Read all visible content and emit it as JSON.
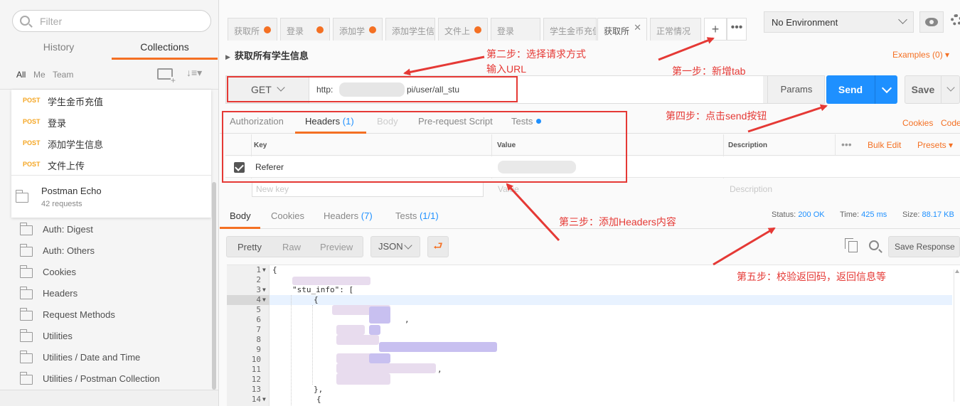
{
  "sidebar": {
    "filter_placeholder": "Filter",
    "tabs": {
      "history": "History",
      "collections": "Collections"
    },
    "filters": {
      "all": "All",
      "me": "Me",
      "team": "Team"
    },
    "requests": [
      {
        "method": "POST",
        "name": "学生金币充值"
      },
      {
        "method": "POST",
        "name": "登录"
      },
      {
        "method": "POST",
        "name": "添加学生信息"
      },
      {
        "method": "POST",
        "name": "文件上传"
      }
    ],
    "echo_collection": {
      "name": "Postman Echo",
      "count": "42 requests"
    },
    "folders": [
      "Auth: Digest",
      "Auth: Others",
      "Cookies",
      "Headers",
      "Request Methods",
      "Utilities",
      "Utilities / Date and Time",
      "Utilities / Postman Collection"
    ]
  },
  "tabs": [
    {
      "label": "获取所",
      "state": "modified"
    },
    {
      "label": "登录",
      "state": "modified"
    },
    {
      "label": "添加学",
      "state": "modified"
    },
    {
      "label": "添加学生信息",
      "state": "plain"
    },
    {
      "label": "文件上",
      "state": "modified"
    },
    {
      "label": "登录",
      "state": "plain"
    },
    {
      "label": "学生金币充值",
      "state": "plain"
    },
    {
      "label": "获取所",
      "state": "active"
    },
    {
      "label": "正常情况",
      "state": "plain"
    }
  ],
  "environment": "No Environment",
  "request": {
    "title": "获取所有学生信息",
    "examples": "Examples (0)",
    "method": "GET",
    "url_prefix": "http:",
    "url_suffix": "pi/user/all_stu",
    "params_label": "Params",
    "send_label": "Send",
    "save_label": "Save"
  },
  "request_tabs": {
    "authorization": "Authorization",
    "headers": "Headers",
    "headers_count": "(1)",
    "body": "Body",
    "prerequest": "Pre-request Script",
    "tests": "Tests",
    "cookies": "Cookies",
    "code": "Code"
  },
  "headers_table": {
    "col_key": "Key",
    "col_value": "Value",
    "col_description": "Description",
    "bulk_edit": "Bulk Edit",
    "presets": "Presets",
    "rows": [
      {
        "key": "Referer",
        "enabled": true
      }
    ],
    "new_key_placeholder": "New key",
    "new_value_placeholder": "Value",
    "new_desc_placeholder": "Description"
  },
  "response": {
    "tabs": {
      "body": "Body",
      "cookies": "Cookies",
      "headers": "Headers",
      "headers_count": "(7)",
      "tests": "Tests",
      "tests_count": "(1/1)"
    },
    "status_label": "Status:",
    "status_value": "200 OK",
    "time_label": "Time:",
    "time_value": "425 ms",
    "size_label": "Size:",
    "size_value": "88.17 KB",
    "view_modes": {
      "pretty": "Pretty",
      "raw": "Raw",
      "preview": "Preview"
    },
    "format": "JSON",
    "save_response": "Save Response",
    "line_numbers": [
      "1",
      "2",
      "3",
      "4",
      "5",
      "6",
      "7",
      "8",
      "9",
      "10",
      "11",
      "12",
      "13",
      "14"
    ],
    "code_lines": {
      "l1": "{",
      "l3": "\"stu_info\": [",
      "l4": "{",
      "l6": ",",
      "l11": ",",
      "l13": "},",
      "l14": "{"
    }
  },
  "annotations": {
    "step1": "第一步：新增tab",
    "step2_line1": "第二步：选择请求方式",
    "step2_line2": "输入URL",
    "step3": "第三步：添加Headers内容",
    "step4": "第四步：点击send按钮",
    "step5": "第五步：校验返回码，返回信息等",
    "color": "#e53935"
  },
  "colors": {
    "accent": "#f47023",
    "send": "#1e90ff"
  }
}
